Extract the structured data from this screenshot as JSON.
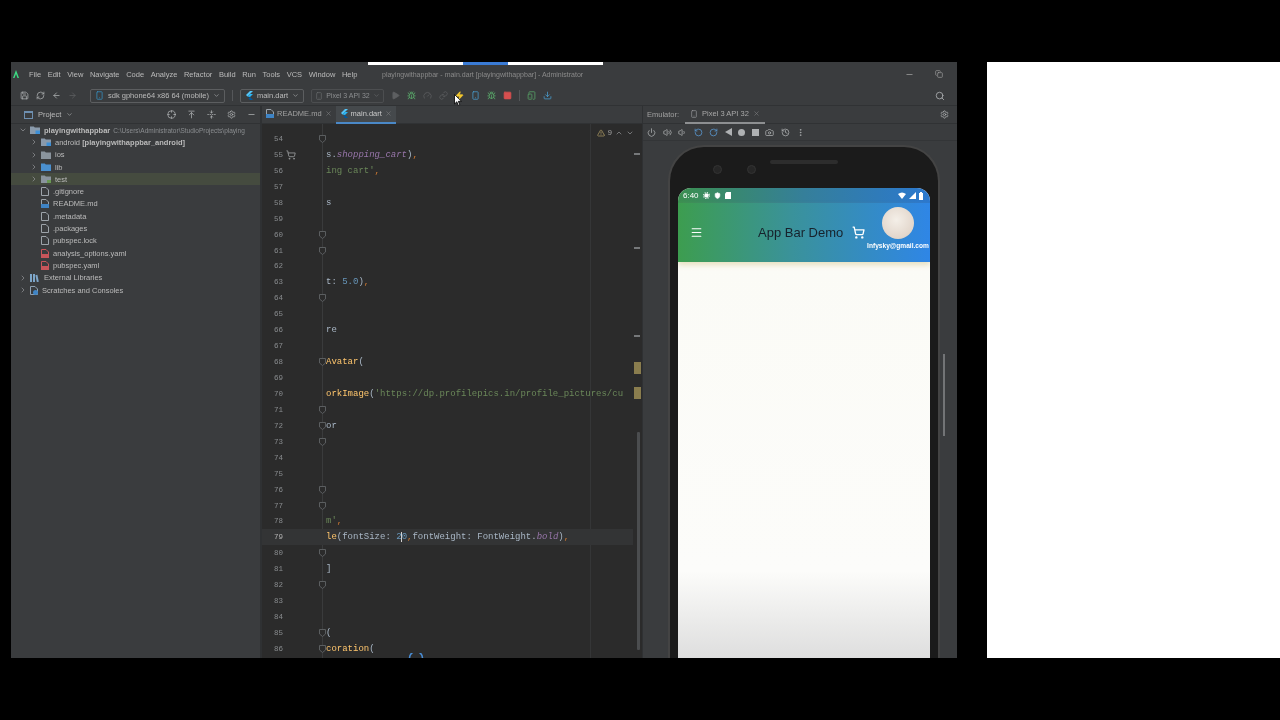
{
  "window": {
    "title": "playingwithappbar - main.dart [playingwithappbar] - Administrator"
  },
  "menu": [
    "File",
    "Edit",
    "View",
    "Navigate",
    "Code",
    "Analyze",
    "Refactor",
    "Build",
    "Run",
    "Tools",
    "VCS",
    "Window",
    "Help"
  ],
  "toolbar": {
    "device_selector": "sdk gphone64 x86 64 (mobile)",
    "run_configuration": "main.dart",
    "target_device": {
      "label": "Pixel 3 API 32",
      "disabled": true
    }
  },
  "project": {
    "title": "Project",
    "tree": [
      {
        "label": "playingwithappbar",
        "detail": "C:\\Users\\Administrator\\StudioProjects\\playing",
        "kind": "module",
        "expanded": true,
        "selected": false,
        "children": [
          {
            "label": "android",
            "detail": "[playingwithappbar_android]",
            "kind": "module",
            "expanded": false,
            "selected": false
          },
          {
            "label": "ios",
            "kind": "folder",
            "expanded": false,
            "selected": false
          },
          {
            "label": "lib",
            "kind": "source_folder",
            "expanded": false,
            "selected": false
          },
          {
            "label": "test",
            "kind": "test_folder",
            "expanded": false,
            "selected": true
          },
          {
            "label": ".gitignore",
            "kind": "file",
            "selected": false
          },
          {
            "label": "README.md",
            "kind": "markdown",
            "selected": false
          },
          {
            "label": ".metadata",
            "kind": "file",
            "selected": false
          },
          {
            "label": ".packages",
            "kind": "file",
            "selected": false
          },
          {
            "label": "pubspec.lock",
            "kind": "file",
            "selected": false
          },
          {
            "label": "analysis_options.yaml",
            "kind": "yaml",
            "selected": false
          },
          {
            "label": "pubspec.yaml",
            "kind": "yaml",
            "selected": false
          }
        ]
      },
      {
        "label": "External Libraries",
        "kind": "libraries",
        "expanded": false,
        "selected": false
      },
      {
        "label": "Scratches and Consoles",
        "kind": "scratches",
        "expanded": false,
        "selected": false
      }
    ]
  },
  "editor": {
    "tabs": [
      {
        "label": "README.md",
        "kind": "markdown",
        "selected": false
      },
      {
        "label": "main.dart",
        "kind": "dart",
        "selected": true
      }
    ],
    "warning_count": "9",
    "lines": [
      {
        "number": "54",
        "fold": true,
        "preview_icon": false,
        "current": false
      },
      {
        "number": "55",
        "fold": false,
        "preview_icon": true,
        "current": false,
        "tokens": [
          {
            "kind": "plain",
            "text": "s."
          },
          {
            "kind": "field",
            "text": "shopping_cart"
          },
          {
            "kind": "plain",
            "text": ")"
          },
          {
            "kind": "punct",
            "text": ","
          }
        ]
      },
      {
        "number": "56",
        "fold": false,
        "preview_icon": false,
        "current": false,
        "tokens": [
          {
            "kind": "string",
            "text": "ing cart'"
          },
          {
            "kind": "punct",
            "text": ","
          }
        ]
      },
      {
        "number": "57",
        "fold": false,
        "preview_icon": false,
        "current": false
      },
      {
        "number": "58",
        "fold": false,
        "preview_icon": false,
        "current": false,
        "tokens": [
          {
            "kind": "plain",
            "text": "s"
          }
        ]
      },
      {
        "number": "59",
        "fold": false,
        "preview_icon": false,
        "current": false
      },
      {
        "number": "60",
        "fold": true,
        "preview_icon": false,
        "current": false
      },
      {
        "number": "61",
        "fold": true,
        "preview_icon": false,
        "current": false
      },
      {
        "number": "62",
        "fold": false,
        "preview_icon": false,
        "current": false
      },
      {
        "number": "63",
        "fold": false,
        "preview_icon": false,
        "current": false,
        "tokens": [
          {
            "kind": "plain",
            "text": "t: "
          },
          {
            "kind": "number",
            "text": "5.0"
          },
          {
            "kind": "plain",
            "text": ")"
          },
          {
            "kind": "punct",
            "text": ","
          }
        ]
      },
      {
        "number": "64",
        "fold": true,
        "preview_icon": false,
        "current": false
      },
      {
        "number": "65",
        "fold": false,
        "preview_icon": false,
        "current": false
      },
      {
        "number": "66",
        "fold": false,
        "preview_icon": false,
        "current": false,
        "tokens": [
          {
            "kind": "plain",
            "text": "re"
          }
        ]
      },
      {
        "number": "67",
        "fold": false,
        "preview_icon": false,
        "current": false
      },
      {
        "number": "68",
        "fold": true,
        "preview_icon": false,
        "current": false,
        "tokens": [
          {
            "kind": "call",
            "text": "Avatar"
          },
          {
            "kind": "plain",
            "text": "("
          }
        ]
      },
      {
        "number": "69",
        "fold": false,
        "preview_icon": false,
        "current": false
      },
      {
        "number": "70",
        "fold": false,
        "preview_icon": false,
        "current": false,
        "tokens": [
          {
            "kind": "call",
            "text": "orkImage"
          },
          {
            "kind": "plain",
            "text": "("
          },
          {
            "kind": "string",
            "text": "'https://dp.profilepics.in/profile_pictures/cu"
          }
        ]
      },
      {
        "number": "71",
        "fold": true,
        "preview_icon": false,
        "current": false
      },
      {
        "number": "72",
        "fold": true,
        "preview_icon": false,
        "current": false,
        "tokens": [
          {
            "kind": "plain",
            "text": "or"
          }
        ]
      },
      {
        "number": "73",
        "fold": true,
        "preview_icon": false,
        "current": false
      },
      {
        "number": "74",
        "fold": false,
        "preview_icon": false,
        "current": false
      },
      {
        "number": "75",
        "fold": false,
        "preview_icon": false,
        "current": false
      },
      {
        "number": "76",
        "fold": true,
        "preview_icon": false,
        "current": false
      },
      {
        "number": "77",
        "fold": true,
        "preview_icon": false,
        "current": false
      },
      {
        "number": "78",
        "fold": false,
        "preview_icon": false,
        "current": false,
        "tokens": [
          {
            "kind": "string",
            "text": "m'"
          },
          {
            "kind": "punct",
            "text": ","
          }
        ]
      },
      {
        "number": "79",
        "fold": false,
        "preview_icon": false,
        "current": true,
        "tokens": [
          {
            "kind": "call",
            "text": "le"
          },
          {
            "kind": "plain",
            "text": "(fontSize: "
          },
          {
            "kind": "number",
            "text": "2"
          },
          {
            "kind": "caret"
          },
          {
            "kind": "number",
            "text": "0"
          },
          {
            "kind": "punct",
            "text": ","
          },
          {
            "kind": "plain",
            "text": "fontWeight: FontWeight."
          },
          {
            "kind": "field",
            "text": "bold"
          },
          {
            "kind": "plain",
            "text": ")"
          },
          {
            "kind": "punct",
            "text": ","
          }
        ]
      },
      {
        "number": "80",
        "fold": true,
        "preview_icon": false,
        "current": false
      },
      {
        "number": "81",
        "fold": false,
        "preview_icon": false,
        "current": false,
        "tokens": [
          {
            "kind": "plain",
            "text": "]"
          }
        ]
      },
      {
        "number": "82",
        "fold": true,
        "preview_icon": false,
        "current": false
      },
      {
        "number": "83",
        "fold": false,
        "preview_icon": false,
        "current": false
      },
      {
        "number": "84",
        "fold": false,
        "preview_icon": false,
        "current": false
      },
      {
        "number": "85",
        "fold": true,
        "preview_icon": false,
        "current": false,
        "tokens": [
          {
            "kind": "plain",
            "text": "("
          }
        ]
      },
      {
        "number": "86",
        "fold": true,
        "preview_icon": false,
        "current": false,
        "tokens": [
          {
            "kind": "call",
            "text": "coration"
          },
          {
            "kind": "plain",
            "text": "("
          }
        ]
      }
    ]
  },
  "emulator": {
    "label": "Emulator:",
    "tabs": [
      {
        "label": "Pixel 3 API 32",
        "selected": true
      }
    ],
    "device": {
      "status_time": "6:40",
      "app_bar": {
        "title": "App Bar Demo",
        "account_email": "Infysky@gmail.com"
      }
    }
  }
}
